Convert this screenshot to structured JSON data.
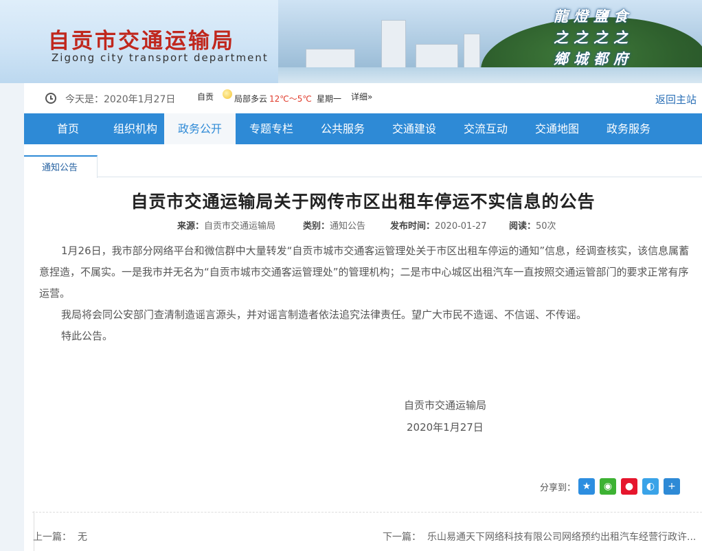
{
  "header": {
    "site_title": "自贡市交通运输局",
    "site_subtitle": "Zigong city transport department",
    "calligraphy_lines": [
      "龍燈鹽食",
      "之之之之",
      "鄉城都府"
    ]
  },
  "infobar": {
    "today_label": "今天是：",
    "today_date": "2020年1月27日",
    "weather_city": "自贡",
    "weather_desc": "局部多云",
    "weather_temp": "12℃～5℃",
    "weekday": "星期一",
    "detail_link": "详细»",
    "home_link": "返回主站",
    "icons": {
      "clock": "clock-icon",
      "weather": "partly-cloudy-icon"
    }
  },
  "nav": {
    "items": [
      "首页",
      "组织机构",
      "政务公开",
      "专题专栏",
      "公共服务",
      "交通建设",
      "交流互动",
      "交通地图",
      "政务服务"
    ],
    "active_index": 2
  },
  "tab": {
    "label": "通知公告"
  },
  "article": {
    "title": "自贡市交通运输局关于网传市区出租车停运不实信息的公告",
    "meta": {
      "source_label": "来源：",
      "source": "自贡市交通运输局",
      "category_label": "类别：",
      "category": "通知公告",
      "date_label": "发布时间：",
      "date": "2020-01-27",
      "views_label": "阅读：",
      "views": "50次"
    },
    "paragraphs": [
      "1月26日，我市部分网络平台和微信群中大量转发“自贡市城市交通客运管理处关于市区出租车停运的通知”信息，经调查核实，该信息属蓄意捏造，不属实。一是我市并无名为“自贡市城市交通客运管理处”的管理机构；二是市中心城区出租汽车一直按照交通运管部门的要求正常有序运营。",
      "我局将会同公安部门查清制造谣言源头，并对谣言制造者依法追究法律责任。望广大市民不造谣、不信谣、不传谣。",
      "特此公告。"
    ],
    "signature_org": "自贡市交通运输局",
    "signature_date": "2020年1月27日"
  },
  "share": {
    "label": "分享到：",
    "buttons": [
      {
        "name": "qzone",
        "glyph": "★",
        "color": "#2d8ee0"
      },
      {
        "name": "wechat",
        "glyph": "◉",
        "color": "#3db233"
      },
      {
        "name": "weibo",
        "glyph": "●",
        "color": "#e6162d"
      },
      {
        "name": "tencent-weibo",
        "glyph": "◐",
        "color": "#3aa3e8"
      },
      {
        "name": "more",
        "glyph": "+",
        "color": "#2e8ad6"
      }
    ]
  },
  "pager": {
    "prev_label": "上一篇：",
    "prev_value": "无",
    "next_label": "下一篇：",
    "next_title": "乐山易通天下网络科技有限公司网络预约出租汽车经营行政许..."
  }
}
